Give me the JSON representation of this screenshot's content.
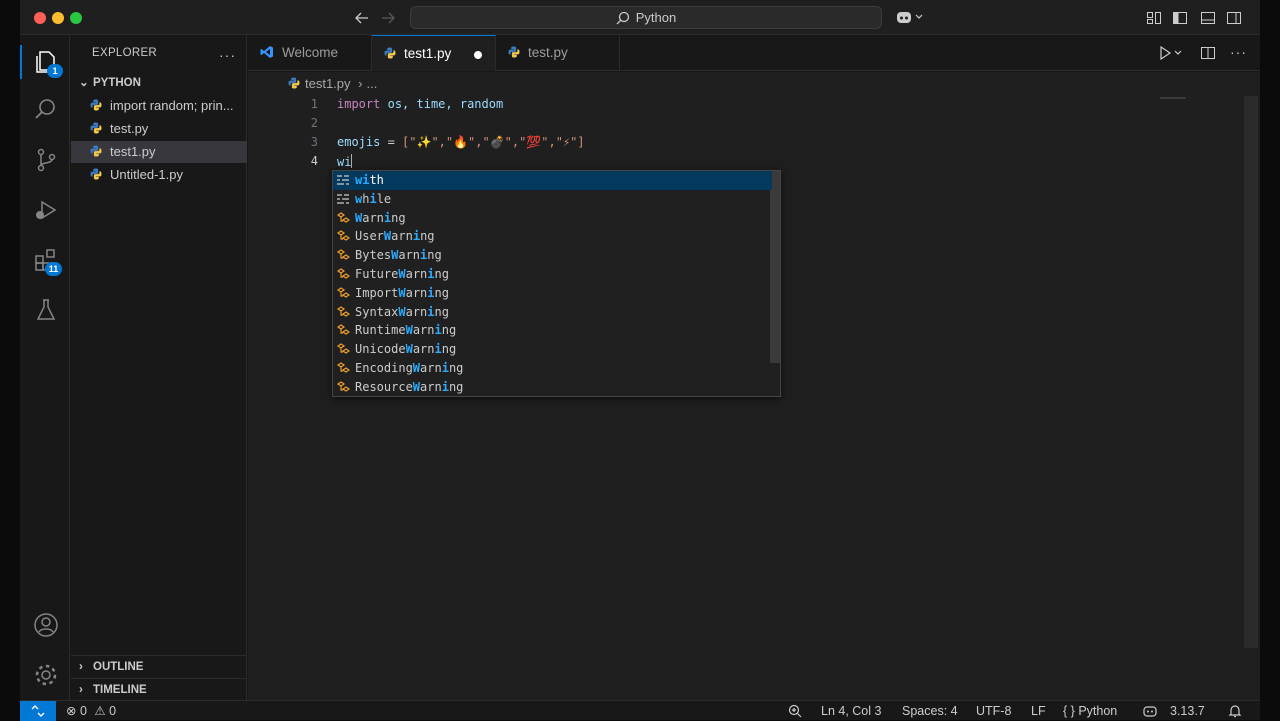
{
  "titlebar": {
    "search_text": "Python"
  },
  "activity_badges": {
    "explorer": "1",
    "extensions": "11"
  },
  "sidebar": {
    "title": "EXPLORER",
    "folder": "PYTHON",
    "files": [
      "import random; prin...",
      "test.py",
      "test1.py",
      "Untitled-1.py"
    ],
    "outline": "OUTLINE",
    "timeline": "TIMELINE"
  },
  "tabs": [
    {
      "label": "Welcome"
    },
    {
      "label": "test1.py"
    },
    {
      "label": "test.py"
    }
  ],
  "editor": {
    "breadcrumb_file": "test1.py",
    "breadcrumb_more": "...",
    "line_numbers": [
      "1",
      "2",
      "3",
      "4"
    ],
    "line1": {
      "kw": "import",
      "rest": "os, time, random"
    },
    "line3": {
      "var": "emojis",
      "eq": " = ",
      "list": "[\"✨\",\"🔥\",\"💣\",\"💯\",\"⚡\"]"
    },
    "line4": "wi"
  },
  "suggestions": [
    {
      "pre": "",
      "hl": "wi",
      "post": "th",
      "kind": "keyword"
    },
    {
      "pre": "",
      "hl": "w",
      "mid": "h",
      "hl2": "i",
      "post": "le",
      "kind": "keyword"
    },
    {
      "pre": "",
      "hl": "W",
      "mid": "arn",
      "hl2": "i",
      "post": "ng",
      "kind": "class"
    },
    {
      "pre": "User",
      "hl": "W",
      "mid": "arn",
      "hl2": "i",
      "post": "ng",
      "kind": "class"
    },
    {
      "pre": "Bytes",
      "hl": "W",
      "mid": "arn",
      "hl2": "i",
      "post": "ng",
      "kind": "class"
    },
    {
      "pre": "Future",
      "hl": "W",
      "mid": "arn",
      "hl2": "i",
      "post": "ng",
      "kind": "class"
    },
    {
      "pre": "Import",
      "hl": "W",
      "mid": "arn",
      "hl2": "i",
      "post": "ng",
      "kind": "class"
    },
    {
      "pre": "Syntax",
      "hl": "W",
      "mid": "arn",
      "hl2": "i",
      "post": "ng",
      "kind": "class"
    },
    {
      "pre": "Runtime",
      "hl": "W",
      "mid": "arn",
      "hl2": "i",
      "post": "ng",
      "kind": "class"
    },
    {
      "pre": "Unicode",
      "hl": "W",
      "mid": "arn",
      "hl2": "i",
      "post": "ng",
      "kind": "class"
    },
    {
      "pre": "Encoding",
      "hl": "W",
      "mid": "arn",
      "hl2": "i",
      "post": "ng",
      "kind": "class"
    },
    {
      "pre": "Resource",
      "hl": "W",
      "mid": "arn",
      "hl2": "i",
      "post": "ng",
      "kind": "class"
    }
  ],
  "status": {
    "errors": "0",
    "warnings": "0",
    "position": "Ln 4, Col 3",
    "spaces": "Spaces: 4",
    "encoding": "UTF-8",
    "eol": "LF",
    "language": "Python",
    "interpreter": "3.13.7"
  },
  "colors": {
    "accent": "#0078d4",
    "python_blue": "#3b7bbf",
    "python_yellow": "#f2c94c"
  }
}
